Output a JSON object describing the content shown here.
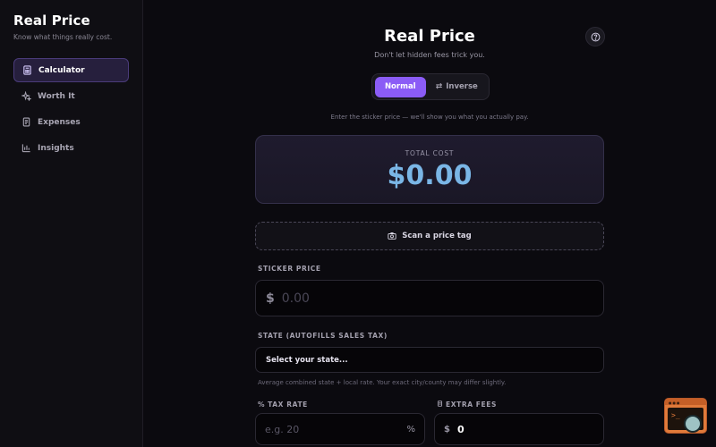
{
  "sidebar": {
    "title": "Real Price",
    "subtitle": "Know what things really cost.",
    "items": [
      {
        "label": "Calculator",
        "icon": "calculator-icon",
        "active": true
      },
      {
        "label": "Worth It",
        "icon": "sparkle-icon",
        "active": false
      },
      {
        "label": "Expenses",
        "icon": "receipt-icon",
        "active": false
      },
      {
        "label": "Insights",
        "icon": "bar-chart-icon",
        "active": false
      }
    ]
  },
  "header": {
    "title": "Real Price",
    "subtitle": "Don't let hidden fees trick you.",
    "help_icon": "help-circle-icon"
  },
  "mode": {
    "normal_label": "Normal",
    "inverse_label": "Inverse",
    "selected": "Normal"
  },
  "hint": "Enter the sticker price — we'll show you what you actually pay.",
  "total": {
    "label": "TOTAL COST",
    "value": "$0.00"
  },
  "scan": {
    "label": "Scan a price tag",
    "icon": "camera-icon"
  },
  "sticker": {
    "label": "STICKER PRICE",
    "currency": "$",
    "placeholder": "0.00",
    "value": ""
  },
  "state": {
    "label": "STATE (AUTOFILLS SALES TAX)",
    "selected": "Select your state...",
    "note": "Average combined state + local rate. Your exact city/county may differ slightly."
  },
  "tax": {
    "label": "TAX RATE",
    "label_icon": "%",
    "placeholder": "e.g. 20",
    "suffix": "%",
    "value": ""
  },
  "fees": {
    "label": "EXTRA FEES",
    "label_icon": "receipt-icon",
    "currency": "$",
    "value": "0"
  },
  "colors": {
    "accent": "#8b5cf6",
    "total_value": "#7ab6e6",
    "background": "#0b0a0f"
  }
}
